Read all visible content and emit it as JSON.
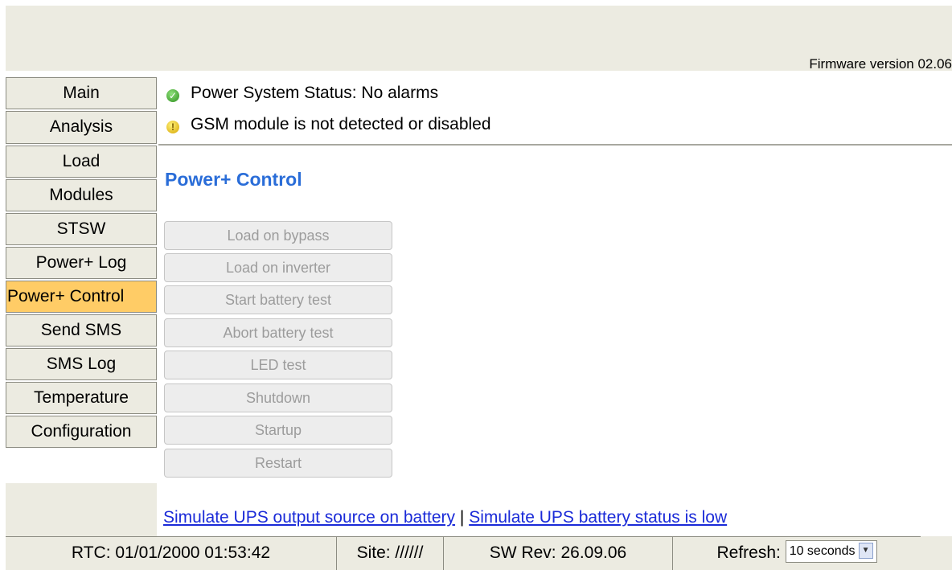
{
  "header": {
    "firmware": "Firmware version 02.06"
  },
  "sidebar": {
    "items": [
      {
        "label": "Main"
      },
      {
        "label": "Analysis"
      },
      {
        "label": "Load"
      },
      {
        "label": "Modules"
      },
      {
        "label": "STSW"
      },
      {
        "label": "Power+ Log"
      },
      {
        "label": "Power+ Control",
        "active": true
      },
      {
        "label": "Send SMS"
      },
      {
        "label": "SMS Log"
      },
      {
        "label": "Temperature"
      },
      {
        "label": "Configuration"
      }
    ]
  },
  "status": {
    "power": {
      "icon": "check-circle-icon",
      "text": "Power System Status: No alarms"
    },
    "gsm": {
      "icon": "warning-circle-icon",
      "text": "GSM module is not detected or disabled"
    }
  },
  "main": {
    "title": "Power+ Control",
    "buttons": [
      "Load on bypass",
      "Load on inverter",
      "Start battery test",
      "Abort battery test",
      "LED test",
      "Shutdown",
      "Startup",
      "Restart"
    ],
    "links": {
      "simulate_battery": "Simulate UPS output source on battery",
      "separator": "|",
      "simulate_low": "Simulate UPS battery status is low"
    }
  },
  "footer": {
    "rtc": "RTC: 01/01/2000 01:53:42",
    "site": "Site: //////",
    "sw_rev": "SW Rev: 26.09.06",
    "refresh_label": "Refresh:",
    "refresh_value": "10 seconds"
  },
  "colors": {
    "active_nav": "#ffcc66",
    "title": "#2a6dd8",
    "link": "#1a2ad8",
    "panel": "#ecebe1"
  }
}
